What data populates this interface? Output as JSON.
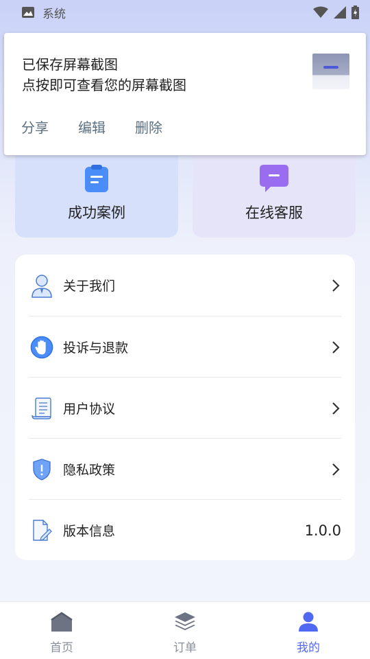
{
  "status_bar": {
    "app_label": "系统"
  },
  "notification": {
    "title": "已保存屏幕截图",
    "subtitle": "点按即可查看您的屏幕截图",
    "actions": [
      "分享",
      "编辑",
      "删除"
    ]
  },
  "cards": [
    {
      "label": "成功案例",
      "icon": "clipboard-icon"
    },
    {
      "label": "在线客服",
      "icon": "chat-icon"
    }
  ],
  "menu": [
    {
      "label": "关于我们",
      "icon": "person-icon"
    },
    {
      "label": "投诉与退款",
      "icon": "hand-stop-icon"
    },
    {
      "label": "用户协议",
      "icon": "scroll-document-icon"
    },
    {
      "label": "隐私政策",
      "icon": "shield-icon"
    },
    {
      "label": "版本信息",
      "icon": "edit-document-icon",
      "value": "1.0.0"
    }
  ],
  "tabs": [
    {
      "label": "首页",
      "icon": "home-icon"
    },
    {
      "label": "订单",
      "icon": "layers-icon"
    },
    {
      "label": "我的",
      "icon": "user-icon",
      "active": true
    }
  ],
  "colors": {
    "accent": "#5169f2",
    "card_left": "#d7e0fb",
    "card_right": "#e6e4f8"
  }
}
